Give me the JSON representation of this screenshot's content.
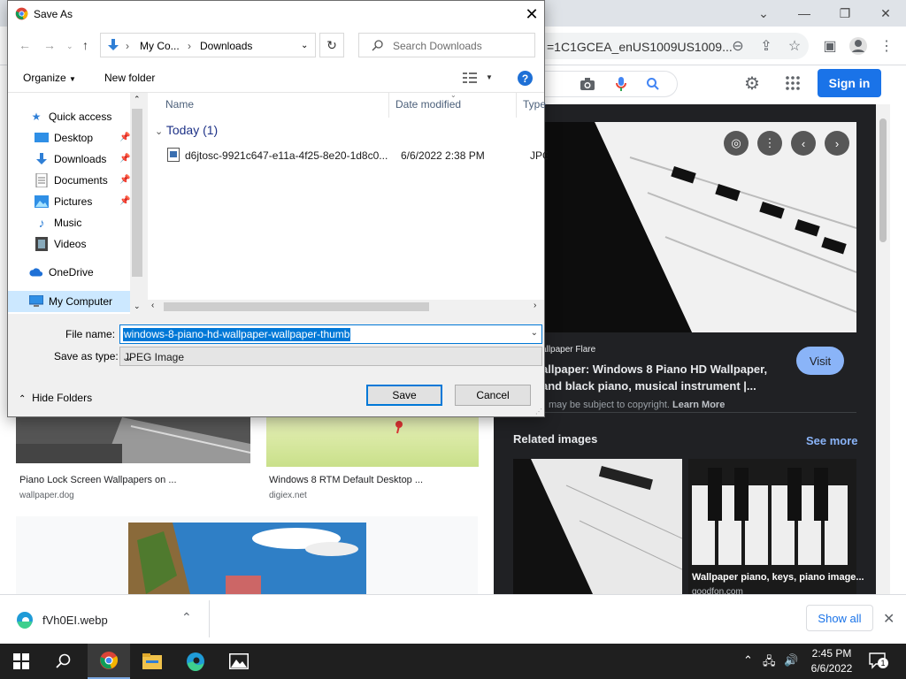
{
  "browser": {
    "url_text": "=1C1GCEA_enUS1009US1009...",
    "sign_in": "Sign in"
  },
  "results": [
    {
      "caption": "Piano Lock Screen Wallpapers on ...",
      "source": "wallpaper.dog"
    },
    {
      "caption": "Windows 8 RTM Default Desktop ...",
      "source": "digiex.net"
    }
  ],
  "panel": {
    "source_name": "allpaper Flare",
    "title_line1": "allpaper: Windows 8 Piano HD Wallpaper,",
    "title_line2": "and black piano, musical instrument |...",
    "visit": "Visit",
    "copyright_text": "may be subject to copyright.",
    "learn_more": "Learn More",
    "related_title": "Related images",
    "see_more": "See more",
    "related_caption": "Wallpaper piano, keys, piano image...",
    "related_source": "goodfon.com"
  },
  "download_bar": {
    "file_name": "fVh0EI.webp",
    "show_all": "Show all"
  },
  "taskbar": {
    "time": "2:45 PM",
    "date": "6/6/2022",
    "notification_count": "1"
  },
  "dialog": {
    "title": "Save As",
    "breadcrumb": [
      "My Co...",
      "Downloads"
    ],
    "search_placeholder": "Search Downloads",
    "organize": "Organize",
    "new_folder": "New folder",
    "help": "?",
    "nav_items": [
      {
        "label": "Quick access",
        "icon": "star-icon"
      },
      {
        "label": "Desktop",
        "icon": "desktop-icon",
        "pinned": true
      },
      {
        "label": "Downloads",
        "icon": "download-arrow-icon",
        "pinned": true
      },
      {
        "label": "Documents",
        "icon": "document-icon",
        "pinned": true
      },
      {
        "label": "Pictures",
        "icon": "pictures-icon",
        "pinned": true
      },
      {
        "label": "Music",
        "icon": "music-icon"
      },
      {
        "label": "Videos",
        "icon": "video-icon"
      },
      {
        "label": "OneDrive",
        "icon": "cloud-icon"
      },
      {
        "label": "My Computer",
        "icon": "computer-icon"
      }
    ],
    "columns": {
      "name": "Name",
      "date_modified": "Date modified",
      "type": "Type"
    },
    "group_label": "Today (1)",
    "files": [
      {
        "name": "d6jtosc-9921c647-e11a-4f25-8e20-1d8c0...",
        "date": "6/6/2022 2:38 PM",
        "type": "JPG F"
      }
    ],
    "file_name_label": "File name:",
    "file_name_value": "windows-8-piano-hd-wallpaper-wallpaper-thumb",
    "save_type_label": "Save as type:",
    "save_type_value": "JPEG Image",
    "hide_folders": "Hide Folders",
    "save": "Save",
    "cancel": "Cancel"
  },
  "colors": {
    "accent": "#0078d7",
    "google_blue": "#1a73e8",
    "panel_bg": "#202124",
    "taskbar_bg": "#1f1f1f"
  }
}
